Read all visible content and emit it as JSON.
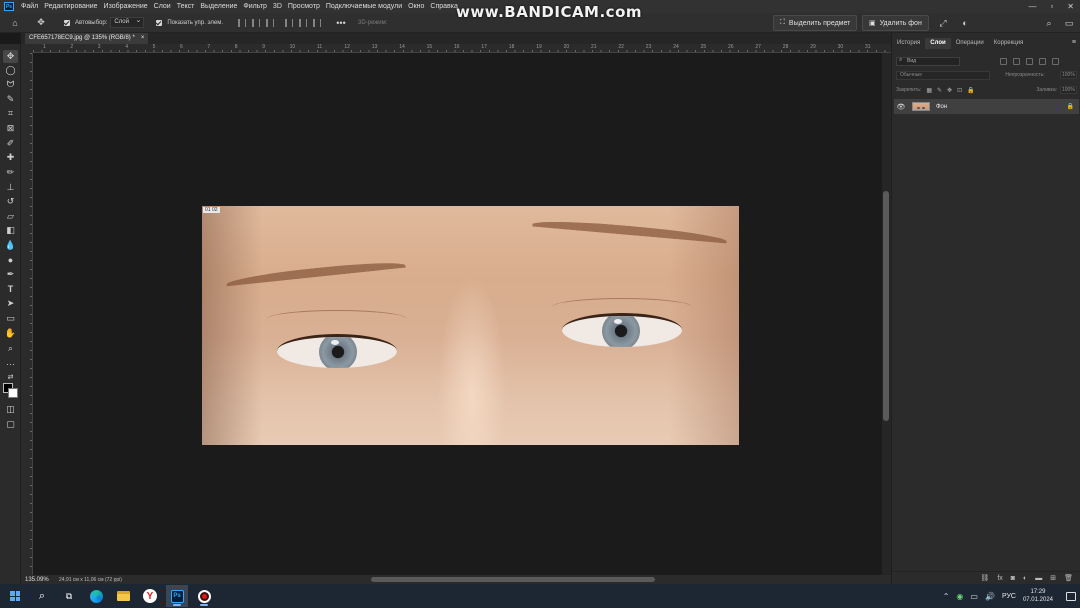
{
  "menu": {
    "logo": "Ps",
    "items": [
      "Файл",
      "Редактирование",
      "Изображение",
      "Слои",
      "Текст",
      "Выделение",
      "Фильтр",
      "3D",
      "Просмотр",
      "Подключаемые модули",
      "Окно",
      "Справка"
    ],
    "window_controls": [
      "—",
      "▫",
      "✕"
    ]
  },
  "watermark": "www.BANDICAM.com",
  "options": {
    "auto_select_label": "Автовыбор:",
    "auto_select_value": "Слой",
    "show_transform_label": "Показать упр. элем.",
    "mode_3d_label": "3D-режим:",
    "select_subject_button": "Выделить предмет",
    "remove_bg_button": "Удалить фон"
  },
  "document": {
    "tab_title": "CFE657178EC9.jpg @ 135% (RGB/8) *",
    "tab_close": "×",
    "zoom": "135.09%",
    "size_info": "24,91 см x 11,06 см (72 ppi)",
    "photo_badge": "01 02"
  },
  "rulers": {
    "top_ticks": [
      "1",
      "2",
      "3",
      "4",
      "5",
      "6",
      "7",
      "8",
      "9",
      "10",
      "11",
      "12",
      "13",
      "14",
      "15",
      "16",
      "17",
      "18",
      "19",
      "20",
      "21",
      "22",
      "23",
      "24",
      "25",
      "26",
      "27",
      "28",
      "29",
      "30",
      "31"
    ]
  },
  "layers_panel": {
    "tabs": [
      "История",
      "Слои",
      "Операции",
      "Коррекция"
    ],
    "active_tab": "Слои",
    "filter_placeholder": "Вид",
    "blend_mode": "Обычные",
    "opacity_label": "Непрозрачность:",
    "opacity_value": "100%",
    "lock_label": "Закрепить:",
    "fill_label": "Заливка:",
    "fill_value": "100%",
    "layers": [
      {
        "name": "Фон",
        "visible": true,
        "locked": true
      }
    ]
  },
  "taskbar": {
    "lang": "РУС",
    "time": "17:29",
    "date": "07.01.2024"
  },
  "colors": {
    "foreground": "#000000",
    "background": "#ffffff",
    "accent_blue": "#31a8ff"
  }
}
